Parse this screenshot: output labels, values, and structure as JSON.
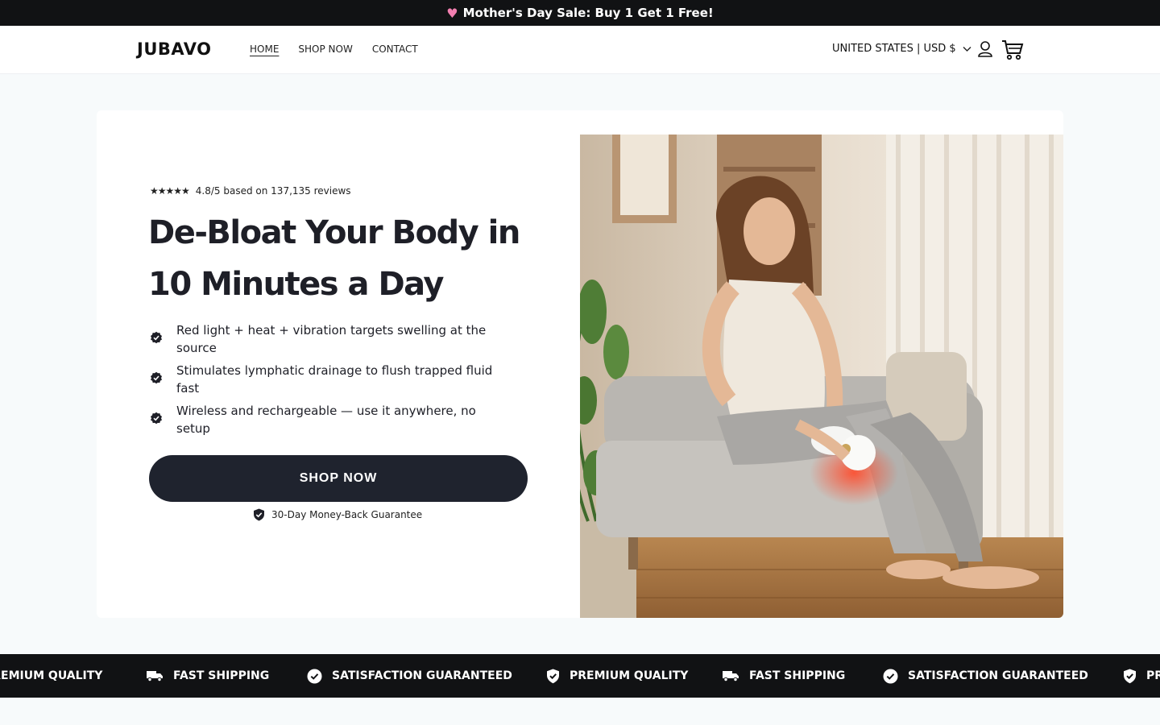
{
  "announcement": {
    "icon": "heart-emoji",
    "text": "Mother's Day Sale: Buy 1 Get 1 Free!"
  },
  "header": {
    "logo": "JUBAVO",
    "nav": [
      {
        "label": "HOME",
        "active": true
      },
      {
        "label": "SHOP NOW",
        "active": false
      },
      {
        "label": "CONTACT",
        "active": false
      }
    ],
    "locale": "UNITED STATES | USD $",
    "icons": [
      "account-icon",
      "cart-icon"
    ]
  },
  "hero": {
    "stars": "★★★★★",
    "rating_text": "4.8/5 based on 137,135 reviews",
    "headline": "De-Bloat Your Body in 10 Minutes a Day",
    "bullets": [
      "Red light + heat + vibration targets swelling at the source",
      "Stimulates lymphatic drainage to flush trapped fluid fast",
      "Wireless and rechargeable — use it anywhere, no setup"
    ],
    "cta": "SHOP NOW",
    "guarantee": "30-Day Money-Back Guarantee"
  },
  "trust_strip": {
    "items": [
      {
        "icon": "shield-check-icon",
        "label": "PREMIUM QUALITY"
      },
      {
        "icon": "truck-icon",
        "label": "FAST SHIPPING"
      },
      {
        "icon": "check-circle-icon",
        "label": "SATISFACTION GUARANTEED"
      },
      {
        "icon": "shield-check-icon",
        "label": "PREMIUM QUALITY"
      },
      {
        "icon": "truck-icon",
        "label": "FAST SHIPPING"
      },
      {
        "icon": "check-circle-icon",
        "label": "SATISFACTION GUARANTEED"
      },
      {
        "icon": "shield-check-icon",
        "label": "PREMIUM QUALITY"
      }
    ]
  },
  "colors": {
    "accent": "#1f232e",
    "announcement_bg": "#111214",
    "page_bg": "#f7fafb"
  }
}
